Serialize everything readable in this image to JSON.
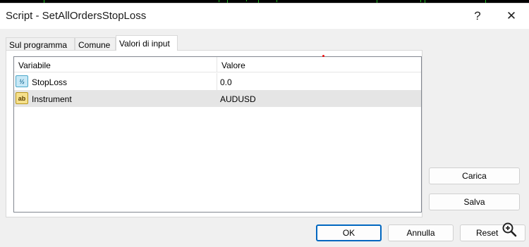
{
  "window": {
    "title": "Script - SetAllOrdersStopLoss",
    "help_glyph": "?",
    "close_glyph": "✕"
  },
  "tabs": [
    {
      "label": "Sul programma",
      "active": false
    },
    {
      "label": "Comune",
      "active": false
    },
    {
      "label": "Valori di input",
      "active": true
    }
  ],
  "grid": {
    "columns": [
      "Variabile",
      "Valore"
    ],
    "rows": [
      {
        "icon": "double-type-icon",
        "icon_text": "½",
        "name": "StopLoss",
        "value": "0.0",
        "selected": false
      },
      {
        "icon": "string-type-icon",
        "icon_text": "ab",
        "name": "Instrument",
        "value": "AUDUSD",
        "selected": true
      }
    ]
  },
  "side_buttons": {
    "load": "Carica",
    "save": "Salva"
  },
  "footer_buttons": {
    "ok": "OK",
    "cancel": "Annulla",
    "reset": "Reset"
  },
  "colors": {
    "accent": "#0067c0",
    "selection": "#e5e5e5",
    "chart_line": "#1dbb1d"
  }
}
